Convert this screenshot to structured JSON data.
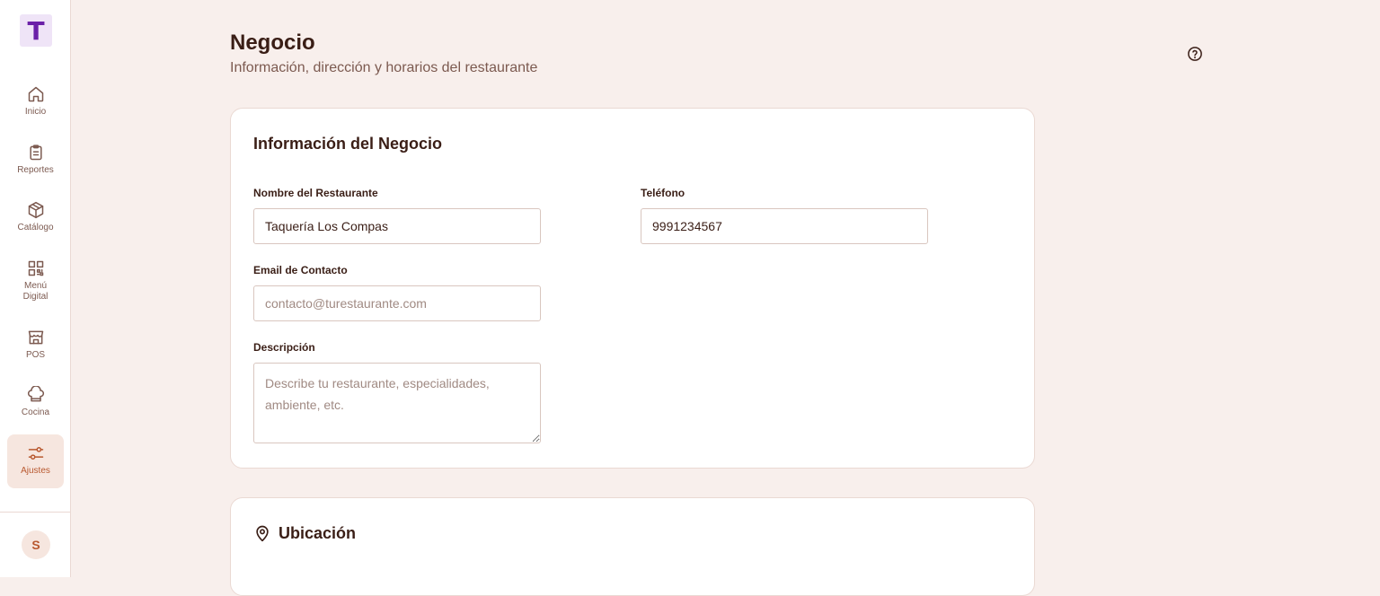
{
  "app": {
    "logo_letter": "T",
    "nav": [
      {
        "label": "Inicio",
        "icon": "home-icon"
      },
      {
        "label": "Reportes",
        "icon": "clipboard-icon"
      },
      {
        "label": "Catálogo",
        "icon": "box-icon"
      },
      {
        "label": "Menú Digital",
        "icon": "qr-code-icon"
      },
      {
        "label": "POS",
        "icon": "store-icon"
      },
      {
        "label": "Cocina",
        "icon": "chef-hat-icon"
      },
      {
        "label": "Ajustes",
        "icon": "sliders-icon",
        "active": true
      }
    ],
    "user_initial": "S"
  },
  "header": {
    "title": "Negocio",
    "subtitle": "Información, dirección y horarios del restaurante"
  },
  "business_card": {
    "title": "Información del Negocio",
    "name_label": "Nombre del Restaurante",
    "name_value": "Taquería Los Compas",
    "phone_label": "Teléfono",
    "phone_value": "9991234567",
    "email_label": "Email de Contacto",
    "email_placeholder": "contacto@turestaurante.com",
    "description_label": "Descripción",
    "description_placeholder": "Describe tu restaurante, especialidades, ambiente, etc."
  },
  "location_card": {
    "title": "Ubicación"
  },
  "colors": {
    "accent": "#b8582f",
    "background": "#f8efec",
    "logo": "#6b21a8"
  }
}
